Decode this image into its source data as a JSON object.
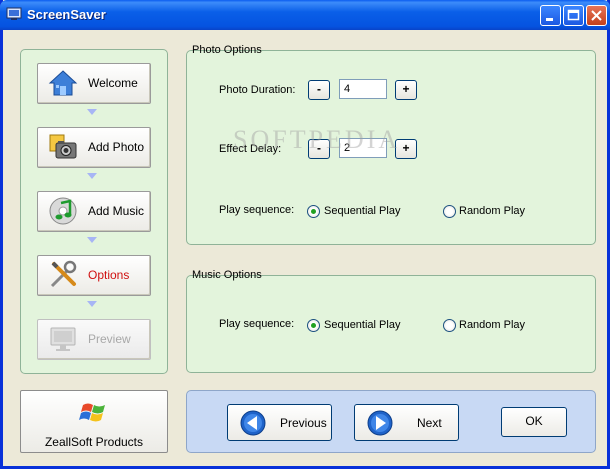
{
  "window": {
    "title": "ScreenSaver"
  },
  "nav": {
    "items": [
      {
        "label": "Welcome",
        "icon": "home-icon"
      },
      {
        "label": "Add Photo",
        "icon": "camera-icon"
      },
      {
        "label": "Add Music",
        "icon": "music-icon"
      },
      {
        "label": "Options",
        "icon": "tools-icon"
      },
      {
        "label": "Preview",
        "icon": "monitor-icon"
      }
    ]
  },
  "photo_options": {
    "title": "Photo Options",
    "duration": {
      "label": "Photo Duration:",
      "value": "4",
      "minus": "-",
      "plus": "+"
    },
    "delay": {
      "label": "Effect Delay:",
      "value": "2",
      "minus": "-",
      "plus": "+"
    },
    "sequence": {
      "label": "Play sequence:",
      "option_sequential": "Sequential Play",
      "option_random": "Random Play",
      "selected": "Sequential Play"
    }
  },
  "music_options": {
    "title": "Music Options",
    "sequence": {
      "label": "Play sequence:",
      "option_sequential": "Sequential Play",
      "option_random": "Random Play",
      "selected": "Sequential Play"
    }
  },
  "zeallsoft": {
    "label": "ZeallSoft Products",
    "icon": "windows-logo-icon"
  },
  "actions": {
    "previous": "Previous",
    "next": "Next",
    "ok": "OK"
  },
  "watermark": "SOFTPEDIA",
  "colors": {
    "title_bar": "#0a5fe8",
    "panel_green": "#e3f4dc",
    "action_blue": "#c8d9f4",
    "active_label": "#d01010"
  }
}
